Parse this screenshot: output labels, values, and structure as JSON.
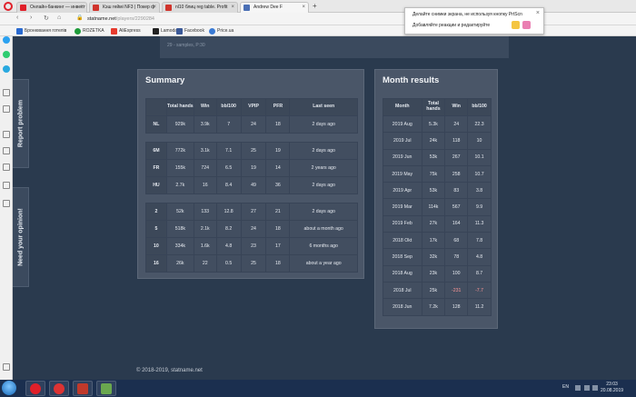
{
  "browser": {
    "tabs": [
      {
        "title": "Онлайн-банкинг — инвест",
        "color": "#e0202a"
      },
      {
        "title": "Кэш геймі NF3 | Покер ф",
        "color": "#d0342c"
      },
      {
        "title": "nl10 блиц reg table. Profit",
        "color": "#d0342c"
      },
      {
        "title": "Andrew Dee F",
        "color": "#4a6fb5"
      }
    ],
    "url_domain": "statname.net",
    "url_path": "/players/2290284",
    "bookmarks": [
      "Бронювання готелів",
      "ROZETKA",
      "AliExpress",
      "Lamoda",
      "Facebook",
      "Price.ua"
    ],
    "popup_line1": "Делайте снимки экрана, не используя кнопку PrtScn",
    "popup_line2": "Добавляйте реакции и редактируйте"
  },
  "page": {
    "samples_text": "29 - samples, P:30",
    "report_problem": "Report problem",
    "need_opinion": "Need your opinion!",
    "footer": "© 2018-2019, statname.net"
  },
  "summary": {
    "title": "Summary",
    "headers": [
      "",
      "Total hands",
      "Win",
      "bb/100",
      "VPIP",
      "PFR",
      "Last seen"
    ],
    "groups": [
      [
        [
          "NL",
          "929k",
          "3.9k",
          "7",
          "24",
          "18",
          "2 days ago"
        ]
      ],
      [
        [
          "6M",
          "772k",
          "3.1k",
          "7.1",
          "25",
          "19",
          "2 days ago"
        ],
        [
          "FR",
          "155k",
          "724",
          "6.5",
          "19",
          "14",
          "2 years ago"
        ],
        [
          "HU",
          "2.7k",
          "16",
          "8.4",
          "49",
          "36",
          "2 days ago"
        ]
      ],
      [
        [
          "2",
          "52k",
          "133",
          "12.8",
          "27",
          "21",
          "2 days ago"
        ],
        [
          "5",
          "518k",
          "2.1k",
          "8.2",
          "24",
          "18",
          "about a month ago"
        ],
        [
          "10",
          "334k",
          "1.6k",
          "4.8",
          "23",
          "17",
          "6 months ago"
        ],
        [
          "16",
          "26k",
          "22",
          "0.5",
          "25",
          "18",
          "about a year ago"
        ]
      ]
    ]
  },
  "month": {
    "title": "Month results",
    "headers": [
      "Month",
      "Total hands",
      "Win",
      "bb/100"
    ],
    "rows": [
      [
        "2019 Aug",
        "5.3k",
        "24",
        "22.3"
      ],
      [
        "2019 Jul",
        "24k",
        "118",
        "10"
      ],
      [
        "2019 Jun",
        "53k",
        "267",
        "10.1"
      ],
      [
        "2019 May",
        "75k",
        "258",
        "10.7"
      ],
      [
        "2019 Apr",
        "53k",
        "83",
        "3.8"
      ],
      [
        "2019 Mar",
        "114k",
        "567",
        "9.9"
      ],
      [
        "2019 Feb",
        "27k",
        "164",
        "11.3"
      ],
      [
        "2018 Okt",
        "17k",
        "68",
        "7.8"
      ],
      [
        "2018 Sep",
        "32k",
        "78",
        "4.8"
      ],
      [
        "2018 Aug",
        "23k",
        "100",
        "8.7"
      ],
      [
        "2018 Jul",
        "25k",
        "-231",
        "-7.7"
      ],
      [
        "2018 Jun",
        "7.2k",
        "128",
        "11.2"
      ]
    ]
  },
  "taskbar": {
    "lang": "EN",
    "time": "23:03",
    "date": "20.08.2019"
  }
}
